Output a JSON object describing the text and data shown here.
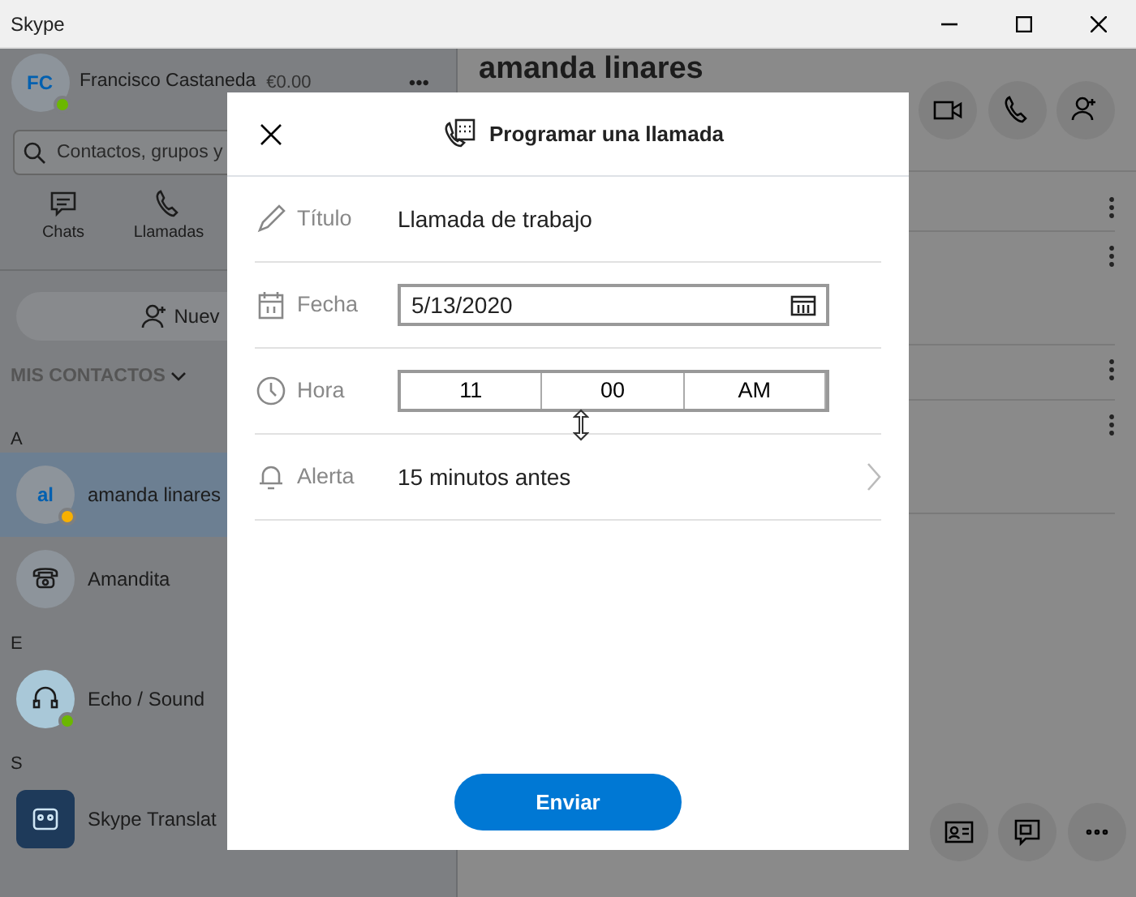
{
  "window": {
    "title": "Skype"
  },
  "profile": {
    "initials": "FC",
    "name": "Francisco Castaneda",
    "credit": "€0.00",
    "more": "•••",
    "color": "#6bb700"
  },
  "search": {
    "placeholder": "Contactos, grupos y"
  },
  "nav_tabs": [
    {
      "label": "Chats",
      "kind": "chat",
      "selected": false
    },
    {
      "label": "Llamadas",
      "kind": "call",
      "selected": false
    }
  ],
  "new_button": {
    "label": "Nuev"
  },
  "contacts_header": "MIS CONTACTOS",
  "contact_groups": [
    {
      "letter": "A",
      "contacts": [
        {
          "name": "amanda linares",
          "kind": "initials",
          "avatar": "al",
          "color": "#f8b000",
          "selected": true
        },
        {
          "name": "Amandita",
          "kind": "phone",
          "selected": false
        }
      ]
    },
    {
      "letter": "E",
      "contacts": [
        {
          "name": "Echo / Sound",
          "kind": "headset",
          "color": "#6bb700",
          "selected": false
        }
      ]
    },
    {
      "letter": "S",
      "contacts": [
        {
          "name": "Skype Translat",
          "kind": "robot",
          "selected": false
        }
      ]
    }
  ],
  "chat": {
    "title": "amanda linares"
  },
  "dialog": {
    "title": "Programar una llamada",
    "fields": [
      {
        "kind": "text",
        "label": "Título",
        "value": "Llamada de trabajo"
      },
      {
        "kind": "date",
        "label": "Fecha",
        "value": "5/13/2020"
      },
      {
        "kind": "time",
        "label": "Hora",
        "parts": [
          "11",
          "00",
          "AM"
        ]
      },
      {
        "kind": "alert",
        "label": "Alerta",
        "value": "15 minutos antes"
      }
    ],
    "submit": "Enviar"
  }
}
